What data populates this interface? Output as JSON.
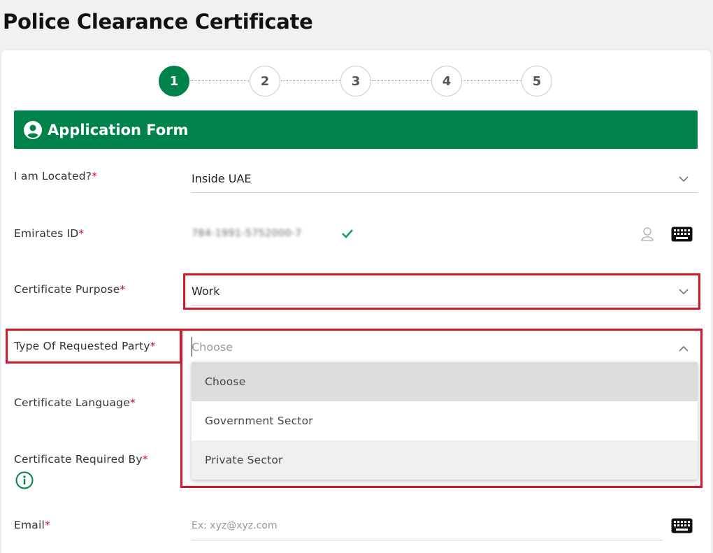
{
  "page": {
    "title": "Police Clearance Certificate"
  },
  "steps": [
    "1",
    "2",
    "3",
    "4",
    "5"
  ],
  "section": {
    "title": "Application Form",
    "icon": "user-circle-icon"
  },
  "form": {
    "located": {
      "label": "I am Located?",
      "required": "*",
      "value": "Inside UAE"
    },
    "emirates_id": {
      "label": "Emirates ID",
      "required": "*",
      "value": "784-1991-5752000-7"
    },
    "purpose": {
      "label": "Certificate Purpose",
      "required": "*",
      "value": "Work"
    },
    "party": {
      "label": "Type Of Requested Party",
      "required": "*",
      "placeholder": "Choose",
      "options": [
        "Choose",
        "Government Sector",
        "Private Sector"
      ]
    },
    "language": {
      "label": "Certificate Language",
      "required": "*"
    },
    "required_by": {
      "label": "Certificate Required By",
      "required": "*"
    },
    "email": {
      "label": "Email",
      "required": "*",
      "placeholder": "Ex: xyz@xyz.com"
    }
  },
  "colors": {
    "primary": "#00834a",
    "highlight": "#d3192b",
    "required": "#c8102e"
  }
}
